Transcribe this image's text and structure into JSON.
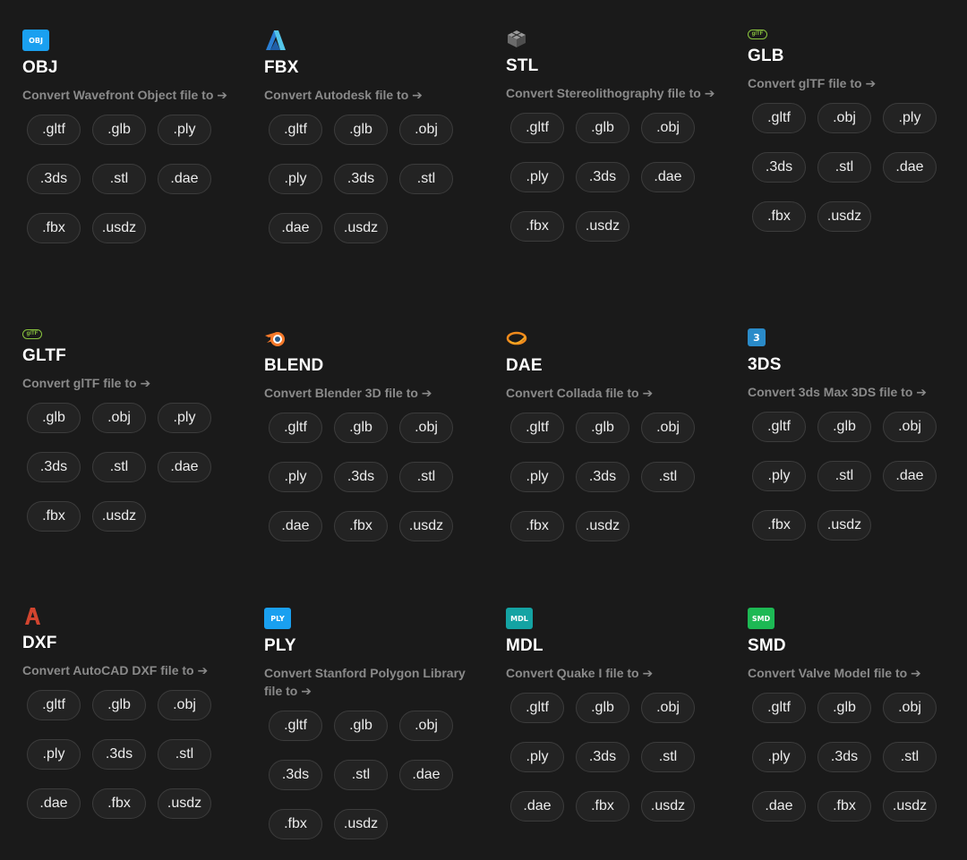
{
  "cards": [
    {
      "key": "obj",
      "title": "OBJ",
      "desc": "Convert Wavefront Object file to ➔",
      "icon": "obj-badge-icon",
      "badge": "OBJ",
      "badge_color": "#1aa0f0",
      "targets": [
        ".gltf",
        ".glb",
        ".ply",
        ".3ds",
        ".stl",
        ".dae",
        ".fbx",
        ".usdz"
      ]
    },
    {
      "key": "fbx",
      "title": "FBX",
      "desc": "Convert Autodesk file to ➔",
      "icon": "autodesk-logo-icon",
      "targets": [
        ".gltf",
        ".glb",
        ".obj",
        ".ply",
        ".3ds",
        ".stl",
        ".dae",
        ".usdz"
      ]
    },
    {
      "key": "stl",
      "title": "STL",
      "desc": "Convert Stereolithography file to ➔",
      "icon": "stl-cube-icon",
      "targets": [
        ".gltf",
        ".glb",
        ".obj",
        ".ply",
        ".3ds",
        ".dae",
        ".fbx",
        ".usdz"
      ]
    },
    {
      "key": "glb",
      "title": "GLB",
      "desc": "Convert glTF file to ➔",
      "icon": "gltf-logo-icon",
      "badge": "glTF",
      "targets": [
        ".gltf",
        ".obj",
        ".ply",
        ".3ds",
        ".stl",
        ".dae",
        ".fbx",
        ".usdz"
      ]
    },
    {
      "key": "gltf",
      "title": "GLTF",
      "desc": "Convert glTF file to ➔",
      "icon": "gltf-logo-icon",
      "badge": "glTF",
      "targets": [
        ".glb",
        ".obj",
        ".ply",
        ".3ds",
        ".stl",
        ".dae",
        ".fbx",
        ".usdz"
      ]
    },
    {
      "key": "blend",
      "title": "BLEND",
      "desc": "Convert Blender 3D file to ➔",
      "icon": "blender-logo-icon",
      "targets": [
        ".gltf",
        ".glb",
        ".obj",
        ".ply",
        ".3ds",
        ".stl",
        ".dae",
        ".fbx",
        ".usdz"
      ]
    },
    {
      "key": "dae",
      "title": "DAE",
      "desc": "Convert Collada file to ➔",
      "icon": "collada-logo-icon",
      "targets": [
        ".gltf",
        ".glb",
        ".obj",
        ".ply",
        ".3ds",
        ".stl",
        ".fbx",
        ".usdz"
      ]
    },
    {
      "key": "3ds",
      "title": "3DS",
      "desc": "Convert 3ds Max 3DS file to ➔",
      "icon": "3ds-max-logo-icon",
      "badge": "3",
      "targets": [
        ".gltf",
        ".glb",
        ".obj",
        ".ply",
        ".stl",
        ".dae",
        ".fbx",
        ".usdz"
      ]
    },
    {
      "key": "dxf",
      "title": "DXF",
      "desc": "Convert AutoCAD DXF file to ➔",
      "icon": "autocad-logo-icon",
      "targets": [
        ".gltf",
        ".glb",
        ".obj",
        ".ply",
        ".3ds",
        ".stl",
        ".dae",
        ".fbx",
        ".usdz"
      ]
    },
    {
      "key": "ply",
      "title": "PLY",
      "desc": "Convert Stanford Polygon Library file to ➔",
      "icon": "ply-badge-icon",
      "badge": "PLY",
      "badge_color": "#1aa0f0",
      "targets": [
        ".gltf",
        ".glb",
        ".obj",
        ".3ds",
        ".stl",
        ".dae",
        ".fbx",
        ".usdz"
      ]
    },
    {
      "key": "mdl",
      "title": "MDL",
      "desc": "Convert Quake I file to ➔",
      "icon": "mdl-badge-icon",
      "badge": "MDL",
      "badge_color": "#14a3a3",
      "targets": [
        ".gltf",
        ".glb",
        ".obj",
        ".ply",
        ".3ds",
        ".stl",
        ".dae",
        ".fbx",
        ".usdz"
      ]
    },
    {
      "key": "smd",
      "title": "SMD",
      "desc": "Convert Valve Model file to ➔",
      "icon": "smd-badge-icon",
      "badge": "SMD",
      "badge_color": "#1db954",
      "targets": [
        ".gltf",
        ".glb",
        ".obj",
        ".ply",
        ".3ds",
        ".stl",
        ".dae",
        ".fbx",
        ".usdz"
      ]
    }
  ]
}
